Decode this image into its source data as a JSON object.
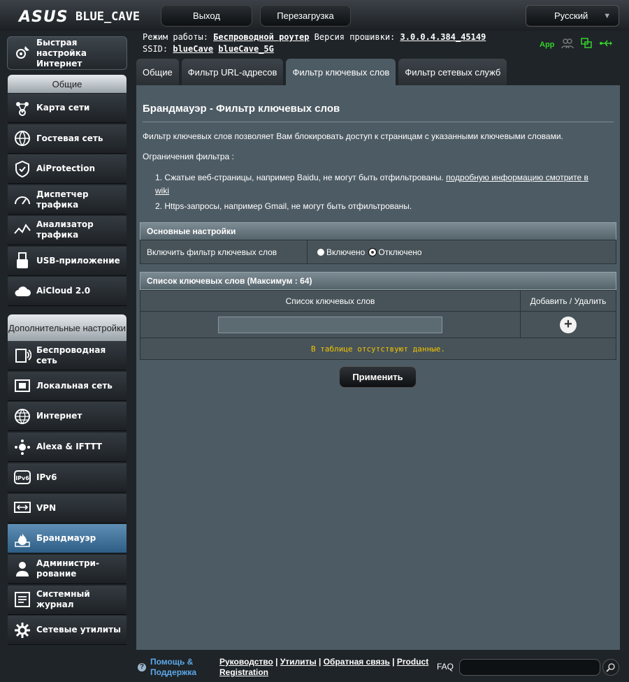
{
  "header": {
    "brand": "ASUS",
    "model": "BLUE_CAVE",
    "logout": "Выход",
    "reboot": "Перезагрузка",
    "language": "Русский"
  },
  "info": {
    "mode_label": "Режим работы:",
    "mode_value": "Беспроводной роутер",
    "fw_label": "Версия прошивки:",
    "fw_value": "3.0.0.4.384_45149",
    "ssid_label": "SSID:",
    "ssid1": "blueCave",
    "ssid2": "blueCave_5G",
    "app_label": "App"
  },
  "sidebar": {
    "quick": "Быстрая настройка Интернет",
    "general_header": "Общие",
    "general": [
      {
        "label": "Карта сети",
        "icon": "network-map-icon"
      },
      {
        "label": "Гостевая сеть",
        "icon": "guest-network-icon"
      },
      {
        "label": "AiProtection",
        "icon": "aiprotection-icon"
      },
      {
        "label": "Диспетчер трафика",
        "icon": "traffic-manager-icon"
      },
      {
        "label": "Анализатор трафика",
        "icon": "traffic-analyzer-icon"
      },
      {
        "label": "USB-приложение",
        "icon": "usb-app-icon"
      },
      {
        "label": "AiCloud 2.0",
        "icon": "aicloud-icon"
      }
    ],
    "advanced_header": "Дополнительные настройки",
    "advanced": [
      {
        "label": "Беспроводная сеть",
        "icon": "wireless-icon"
      },
      {
        "label": "Локальная сеть",
        "icon": "lan-icon"
      },
      {
        "label": "Интернет",
        "icon": "globe-icon"
      },
      {
        "label": "Alexa & IFTTT",
        "icon": "alexa-icon"
      },
      {
        "label": "IPv6",
        "icon": "ipv6-icon"
      },
      {
        "label": "VPN",
        "icon": "vpn-icon"
      },
      {
        "label": "Брандмауэр",
        "icon": "firewall-icon"
      },
      {
        "label": "Администри-рование",
        "icon": "administration-icon"
      },
      {
        "label": "Системный журнал",
        "icon": "system-log-icon"
      },
      {
        "label": "Сетевые утилиты",
        "icon": "network-tools-icon"
      }
    ]
  },
  "tabs": [
    "Общие",
    "Фильтр URL-адресов",
    "Фильтр ключевых слов",
    "Фильтр сетевых служб"
  ],
  "main": {
    "title": "Брандмауэр - Фильтр ключевых слов",
    "description": "Фильтр ключевых слов позволяет Вам блокировать доступ к страницам с указанными ключевыми словами.",
    "limits_header": "Ограничения фильтра :",
    "limit1_text": "1. Сжатые веб-страницы, например Baidu, не могут быть отфильтрованы.",
    "limit1_link": "подробную информацию смотрите в wiki",
    "limit2": "2. Https-запросы, например Gmail, не могут быть отфильтрованы.",
    "basic_header": "Основные настройки",
    "enable_label": "Включить фильтр ключевых слов",
    "on_label": "Включено",
    "off_label": "Отключено",
    "list_header": "Список ключевых слов (Максимум : 64)",
    "col_list": "Список ключевых слов",
    "col_action": "Добавить / Удалить",
    "keyword_value": "",
    "no_data": "В таблице отсутствуют данные.",
    "apply": "Применить"
  },
  "footer": {
    "help": "Помощь & Поддержка",
    "manual": "Руководство",
    "utility": "Утилиты",
    "feedback": "Обратная связь",
    "product_reg": "Product Registration",
    "faq": "FAQ",
    "search_value": ""
  }
}
